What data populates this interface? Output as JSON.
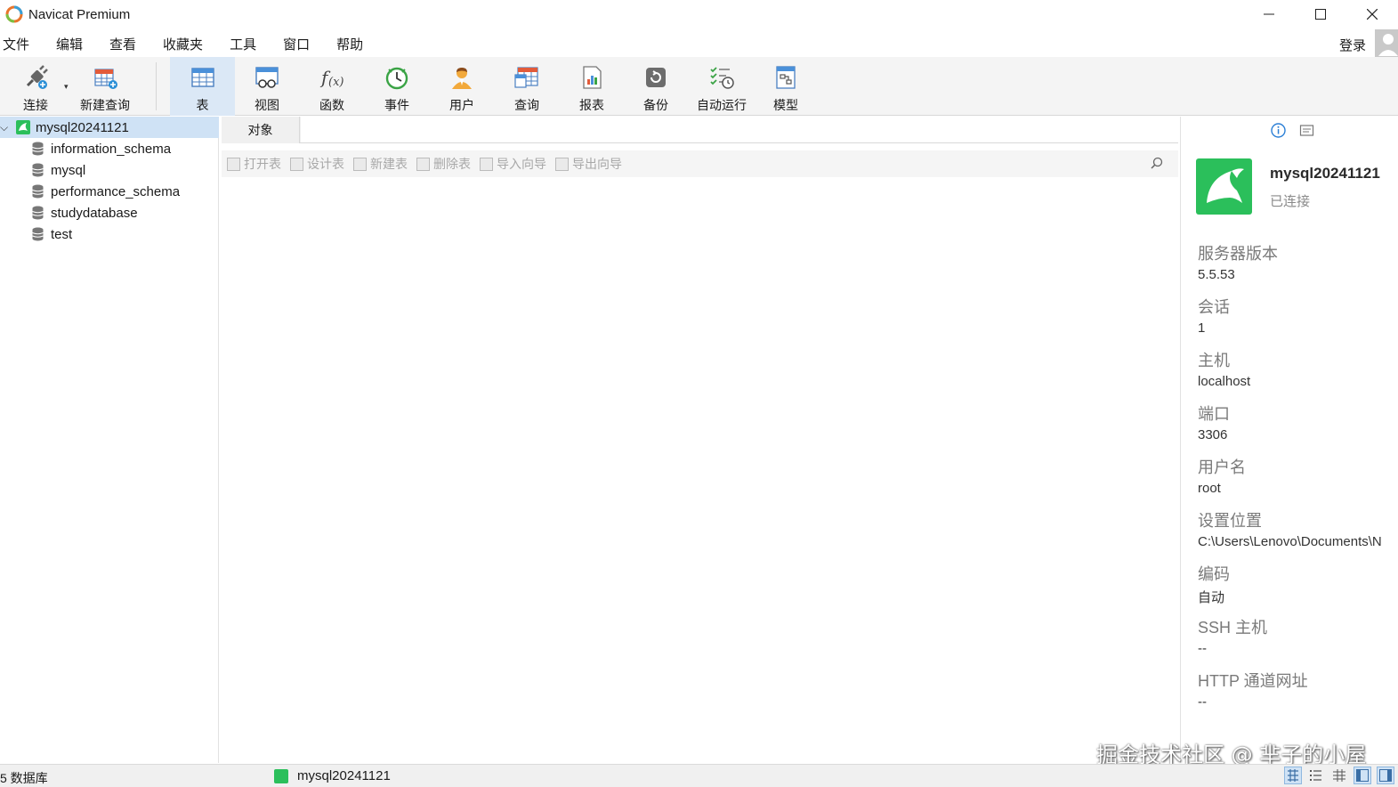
{
  "window": {
    "title": "Navicat Premium"
  },
  "menu": [
    "文件",
    "编辑",
    "查看",
    "收藏夹",
    "工具",
    "窗口",
    "帮助"
  ],
  "account": {
    "login_label": "登录"
  },
  "toolbar": {
    "connect": "连接",
    "new_query": "新建查询",
    "table": "表",
    "view": "视图",
    "function": "函数",
    "event": "事件",
    "user": "用户",
    "query": "查询",
    "report": "报表",
    "backup": "备份",
    "auto_run": "自动运行",
    "model": "模型"
  },
  "navigator": {
    "connection": "mysql20241121",
    "databases": [
      "information_schema",
      "mysql",
      "performance_schema",
      "studydatabase",
      "test"
    ]
  },
  "object_panel": {
    "tab_label": "对象",
    "actions": [
      "打开表",
      "设计表",
      "新建表",
      "删除表",
      "导入向导",
      "导出向导"
    ]
  },
  "info_panel": {
    "connection_name": "mysql20241121",
    "status": "已连接",
    "properties": [
      {
        "key": "服务器版本",
        "value": "5.5.53"
      },
      {
        "key": "会话",
        "value": "1"
      },
      {
        "key": "主机",
        "value": "localhost"
      },
      {
        "key": "端口",
        "value": "3306"
      },
      {
        "key": "用户名",
        "value": "root"
      },
      {
        "key": "设置位置",
        "value": "C:\\Users\\Lenovo\\Documents\\N"
      },
      {
        "key": "编码",
        "value": "自动"
      },
      {
        "key": "SSH 主机",
        "value": "--"
      },
      {
        "key": "HTTP 通道网址",
        "value": "--"
      }
    ]
  },
  "status_bar": {
    "db_count": "5 数据库",
    "connection": "mysql20241121"
  },
  "watermark": "掘金技术社区 @ 芈子的小屋",
  "colors": {
    "accent_selection": "#cfe2f5",
    "connection_green": "#2bbf5b",
    "toolbar_bg": "#f4f4f4"
  }
}
